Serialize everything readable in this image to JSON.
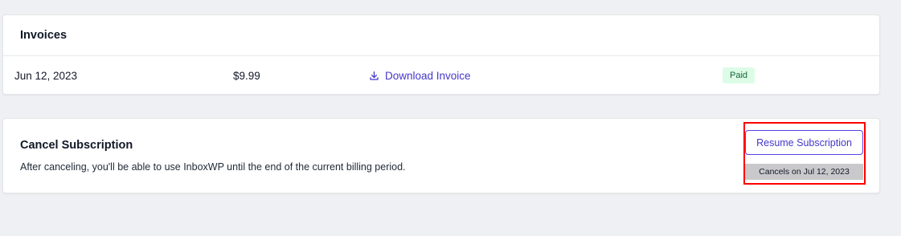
{
  "invoices": {
    "title": "Invoices",
    "rows": [
      {
        "date": "Jun 12, 2023",
        "amount": "$9.99",
        "download_label": "Download Invoice",
        "download_icon": "download-icon",
        "status": "Paid"
      }
    ]
  },
  "cancel": {
    "title": "Cancel Subscription",
    "description": "After canceling, you'll be able to use InboxWP until the end of the current billing period.",
    "resume_label": "Resume Subscription",
    "cancels_on_label": "Cancels on Jul 12, 2023"
  },
  "colors": {
    "accent": "#4338ca",
    "paid_badge_bg": "#dcfce7",
    "paid_badge_text": "#166534",
    "highlight": "#ff0000",
    "page_bg": "#eff0f3"
  }
}
